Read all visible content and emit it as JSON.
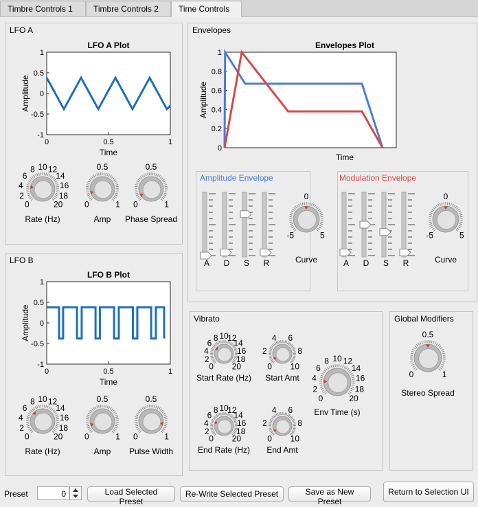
{
  "tabs": [
    {
      "label": "Timbre Controls 1",
      "active": false
    },
    {
      "label": "Timbre Controls 2",
      "active": false
    },
    {
      "label": "Time Controls",
      "active": true
    }
  ],
  "lfo_a": {
    "title": "LFO A",
    "knobs": [
      {
        "name": "rate-knob",
        "label": "Rate (Hz)",
        "ticks": [
          "0",
          "2",
          "4",
          "6",
          "8",
          "10",
          "12",
          "14",
          "16",
          "18",
          "20"
        ],
        "value": 4
      },
      {
        "name": "amp-knob",
        "label": "Amp",
        "ticks": [
          "0",
          "0.5",
          "1"
        ],
        "value": 0.1
      },
      {
        "name": "phase-spread-knob",
        "label": "Phase Spread",
        "ticks": [
          "0",
          "0.5",
          "1"
        ],
        "value": 0.05
      }
    ]
  },
  "lfo_b": {
    "title": "LFO B",
    "knobs": [
      {
        "name": "rate-knob",
        "label": "Rate (Hz)",
        "ticks": [
          "0",
          "2",
          "4",
          "6",
          "8",
          "10",
          "12",
          "14",
          "16",
          "18",
          "20"
        ],
        "value": 6.6
      },
      {
        "name": "amp-knob",
        "label": "Amp",
        "ticks": [
          "0",
          "0.5",
          "1"
        ],
        "value": 0.1
      },
      {
        "name": "pulse-width-knob",
        "label": "Pulse Width",
        "ticks": [
          "0",
          "0.5",
          "1"
        ],
        "value": 0.88
      }
    ]
  },
  "envelopes": {
    "title": "Envelopes",
    "amp_env": {
      "title": "Amplitude Envelope",
      "title_color": "#4a7cd8",
      "sliders": [
        {
          "label": "A",
          "value": 0.0
        },
        {
          "label": "D",
          "value": 0.05
        },
        {
          "label": "S",
          "value": 0.67
        },
        {
          "label": "R",
          "value": 0.05
        }
      ],
      "curve": {
        "label": "Curve",
        "ticks": [
          "-5",
          "0",
          "5"
        ],
        "value": 0
      }
    },
    "mod_env": {
      "title": "Modulation Envelope",
      "title_color": "#d84848",
      "sliders": [
        {
          "label": "A",
          "value": 0.05
        },
        {
          "label": "D",
          "value": 0.5
        },
        {
          "label": "S",
          "value": 0.38
        },
        {
          "label": "R",
          "value": 0.05
        }
      ],
      "curve": {
        "label": "Curve",
        "ticks": [
          "-5",
          "0",
          "5"
        ],
        "value": 0
      }
    }
  },
  "vibrato": {
    "title": "Vibrato",
    "knobs": [
      {
        "name": "start-rate-knob",
        "label": "Start Rate (Hz)",
        "ticks": [
          "0",
          "2",
          "4",
          "6",
          "8",
          "10",
          "12",
          "14",
          "16",
          "18",
          "20"
        ],
        "value": 6
      },
      {
        "name": "start-amt-knob",
        "label": "Start Amt",
        "ticks": [
          "0",
          "2",
          "4",
          "6",
          "8",
          "10"
        ],
        "value": 0.5
      },
      {
        "name": "end-rate-knob",
        "label": "End Rate (Hz)",
        "ticks": [
          "0",
          "2",
          "4",
          "6",
          "8",
          "10",
          "12",
          "14",
          "16",
          "18",
          "20"
        ],
        "value": 5
      },
      {
        "name": "end-amt-knob",
        "label": "End Amt",
        "ticks": [
          "0",
          "2",
          "4",
          "6",
          "8",
          "10"
        ],
        "value": 0.5
      },
      {
        "name": "env-time-knob",
        "label": "Env Time (s)",
        "ticks": [
          "0",
          "2",
          "4",
          "6",
          "8",
          "10",
          "12",
          "14",
          "16",
          "18",
          "20"
        ],
        "value": 3.5
      }
    ]
  },
  "global": {
    "title": "Global Modifiers",
    "knob": {
      "name": "stereo-spread-knob",
      "label": "Stereo Spread",
      "ticks": [
        "0",
        "0.5",
        "1"
      ],
      "value": 0.5
    }
  },
  "bottom": {
    "preset_label": "Preset",
    "preset_value": "0",
    "load_label": "Load Selected Preset",
    "rewrite_label": "Re-Write Selected Preset",
    "save_new_label": "Save as New Preset",
    "return_label": "Return to Selection UI"
  },
  "chart_data": [
    {
      "type": "line",
      "title": "LFO A Plot",
      "xlabel": "Time",
      "ylabel": "Amplitude",
      "xlim": [
        0,
        1
      ],
      "ylim": [
        -1,
        1
      ],
      "xticks": [
        "0",
        "0.5",
        "1"
      ],
      "yticks": [
        "-1",
        "-0.5",
        "0",
        "0.5",
        "1"
      ],
      "color": "#1f6fb8",
      "series": [
        {
          "x": [
            0,
            0.139,
            0.278,
            0.417,
            0.556,
            0.694,
            0.833,
            0.972,
            1.0
          ],
          "y": [
            0.38,
            -0.38,
            0.38,
            -0.38,
            0.38,
            -0.38,
            0.38,
            -0.38,
            -0.3
          ]
        }
      ]
    },
    {
      "type": "line",
      "title": "LFO B Plot",
      "xlabel": "Time",
      "ylabel": "Amplitude",
      "xlim": [
        0,
        1
      ],
      "ylim": [
        -1,
        1
      ],
      "xticks": [
        "0",
        "0.5",
        "1"
      ],
      "yticks": [
        "-1",
        "-0.5",
        "0",
        "0.5",
        "1"
      ],
      "color": "#1f6fb8",
      "series": [
        {
          "x": [
            0,
            0.1,
            0.1,
            0.133,
            0.133,
            0.245,
            0.245,
            0.283,
            0.283,
            0.395,
            0.395,
            0.43,
            0.43,
            0.545,
            0.545,
            0.583,
            0.583,
            0.697,
            0.697,
            0.733,
            0.733,
            0.845,
            0.845,
            0.883,
            0.883,
            0.95,
            0.95
          ],
          "y": [
            0.38,
            0.38,
            -0.38,
            -0.38,
            0.38,
            0.38,
            -0.38,
            -0.38,
            0.38,
            0.38,
            -0.38,
            -0.38,
            0.38,
            0.38,
            -0.38,
            -0.38,
            0.38,
            0.38,
            -0.38,
            -0.38,
            0.38,
            0.38,
            -0.38,
            -0.38,
            0.38,
            0.38,
            -0.38
          ]
        }
      ]
    },
    {
      "type": "line",
      "title": "Envelopes Plot",
      "xlabel": "Time",
      "ylabel": "Amplitude",
      "xlim": [
        0,
        1
      ],
      "ylim": [
        0,
        1
      ],
      "yticks": [
        "0",
        "0.2",
        "0.4",
        "0.6",
        "0.8",
        "1"
      ],
      "series": [
        {
          "color": "#4a7cd8",
          "x": [
            0,
            0.003,
            0.12,
            0.8,
            0.92
          ],
          "y": [
            0,
            1,
            0.67,
            0.67,
            0
          ]
        },
        {
          "color": "#d84848",
          "x": [
            0,
            0.1,
            0.37,
            0.8,
            0.92
          ],
          "y": [
            0,
            1,
            0.38,
            0.38,
            0
          ]
        }
      ]
    }
  ]
}
